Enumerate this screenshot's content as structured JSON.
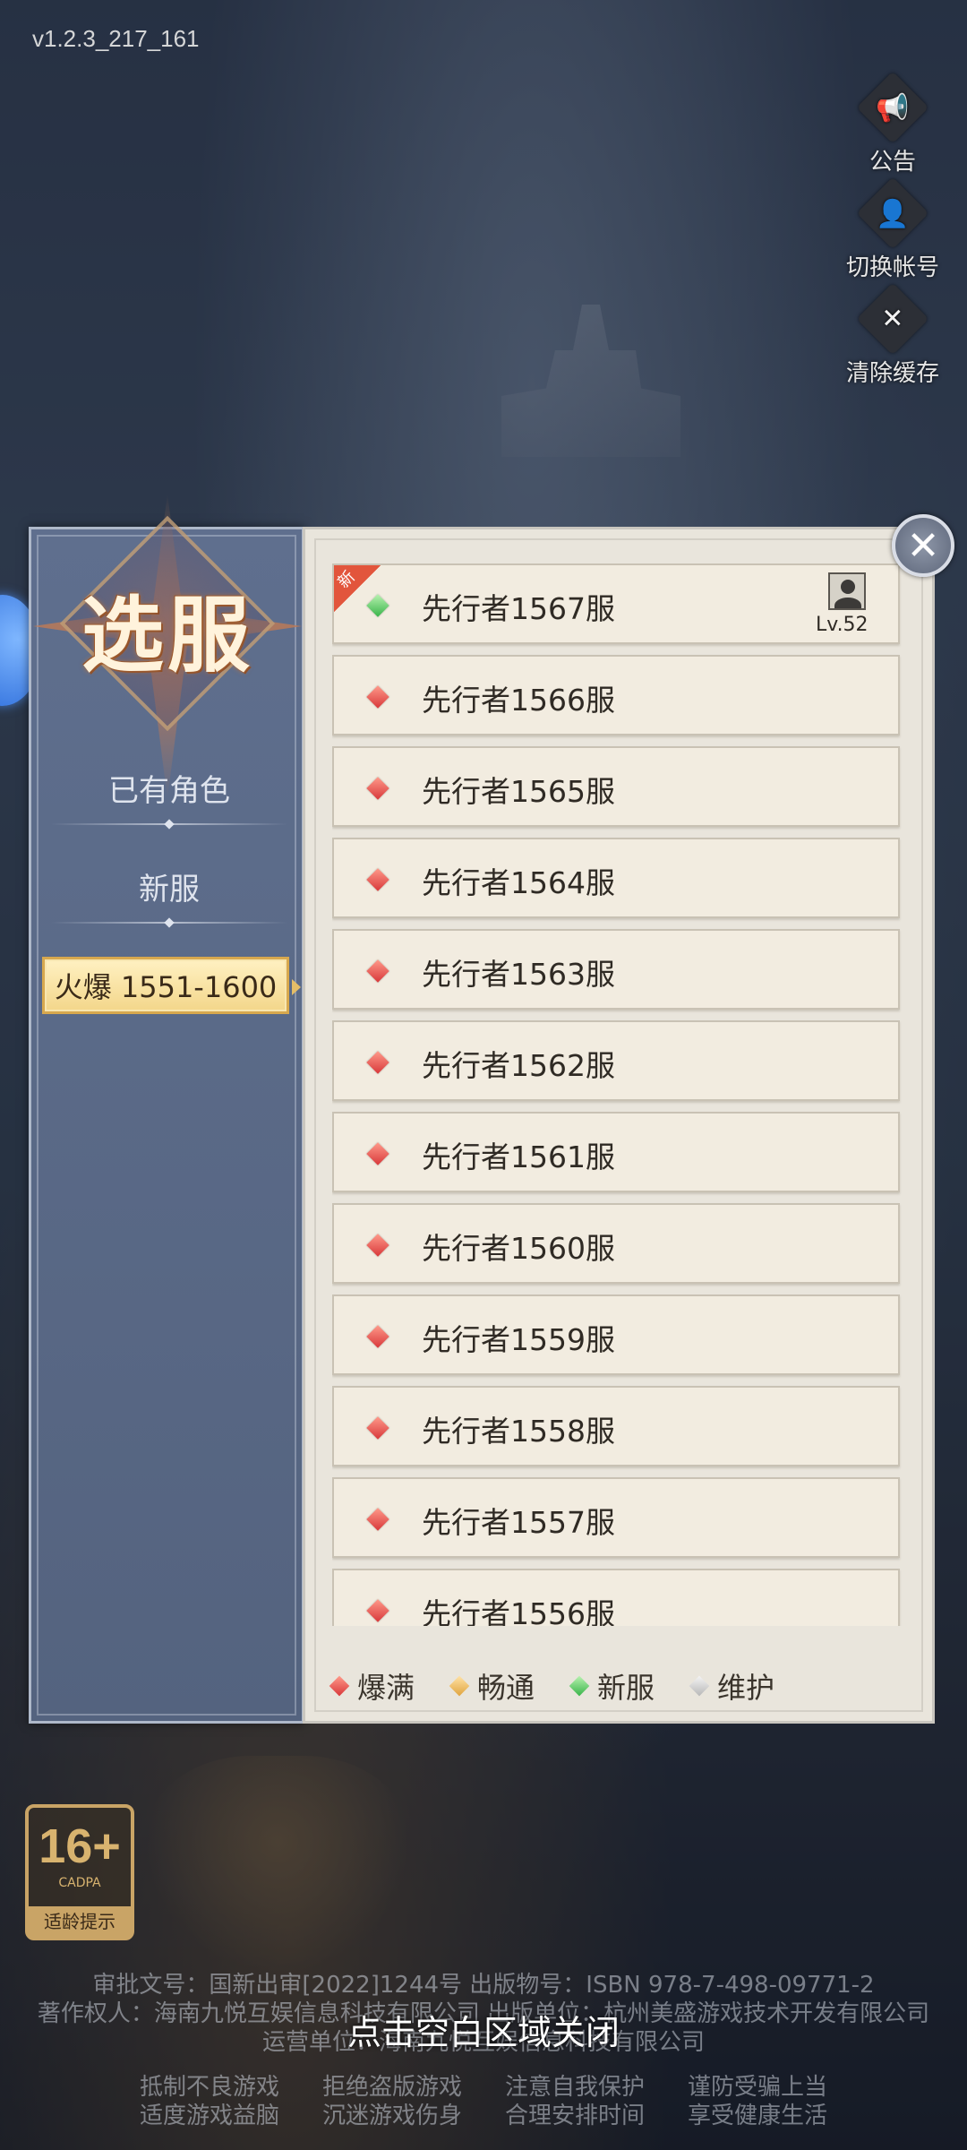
{
  "version": "v1.2.3_217_161",
  "side_buttons": [
    {
      "label": "公告",
      "icon": "megaphone-icon",
      "glyph": "📢"
    },
    {
      "label": "切换帐号",
      "icon": "user-switch-icon",
      "glyph": "👤"
    },
    {
      "label": "清除缓存",
      "icon": "tools-icon",
      "glyph": "✕"
    }
  ],
  "panel": {
    "title": "选服",
    "categories": [
      "已有角色",
      "新服"
    ],
    "active_category": "火爆 1551-1600",
    "servers": [
      {
        "name": "先行者1567服",
        "status": "green",
        "badge": "新",
        "level": "Lv.52"
      },
      {
        "name": "先行者1566服",
        "status": "red"
      },
      {
        "name": "先行者1565服",
        "status": "red"
      },
      {
        "name": "先行者1564服",
        "status": "red"
      },
      {
        "name": "先行者1563服",
        "status": "red"
      },
      {
        "name": "先行者1562服",
        "status": "red"
      },
      {
        "name": "先行者1561服",
        "status": "red"
      },
      {
        "name": "先行者1560服",
        "status": "red"
      },
      {
        "name": "先行者1559服",
        "status": "red"
      },
      {
        "name": "先行者1558服",
        "status": "red"
      },
      {
        "name": "先行者1557服",
        "status": "red"
      },
      {
        "name": "先行者1556服",
        "status": "red"
      }
    ],
    "legend": [
      {
        "label": "爆满",
        "color": "red"
      },
      {
        "label": "畅通",
        "color": "yellow"
      },
      {
        "label": "新服",
        "color": "green"
      },
      {
        "label": "维护",
        "color": "gray"
      }
    ],
    "close_glyph": "✕"
  },
  "age_rating": {
    "number": "16+",
    "sub": "CADPA",
    "tip": "适龄提示"
  },
  "footer": {
    "line1": "审批文号：国新出审[2022]1244号    出版物号：ISBN 978-7-498-09771-2",
    "line2": "著作权人：海南九悦互娱信息科技有限公司  出版单位：杭州美盛游戏技术开发有限公司",
    "line3": "运营单位：海南九悦互娱信息科技有限公司",
    "notice": [
      "抵制不良游戏",
      "拒绝盗版游戏",
      "注意自我保护",
      "谨防受骗上当",
      "适度游戏益脑",
      "沉迷游戏伤身",
      "合理安排时间",
      "享受健康生活"
    ]
  },
  "close_hint": "点击空白区域关闭",
  "colors": {
    "status_red": "#d8383a",
    "status_green": "#39b44a",
    "status_yellow": "#e0a43e",
    "status_gray": "#b7b7b7",
    "accent_gold": "#d7a84e"
  }
}
